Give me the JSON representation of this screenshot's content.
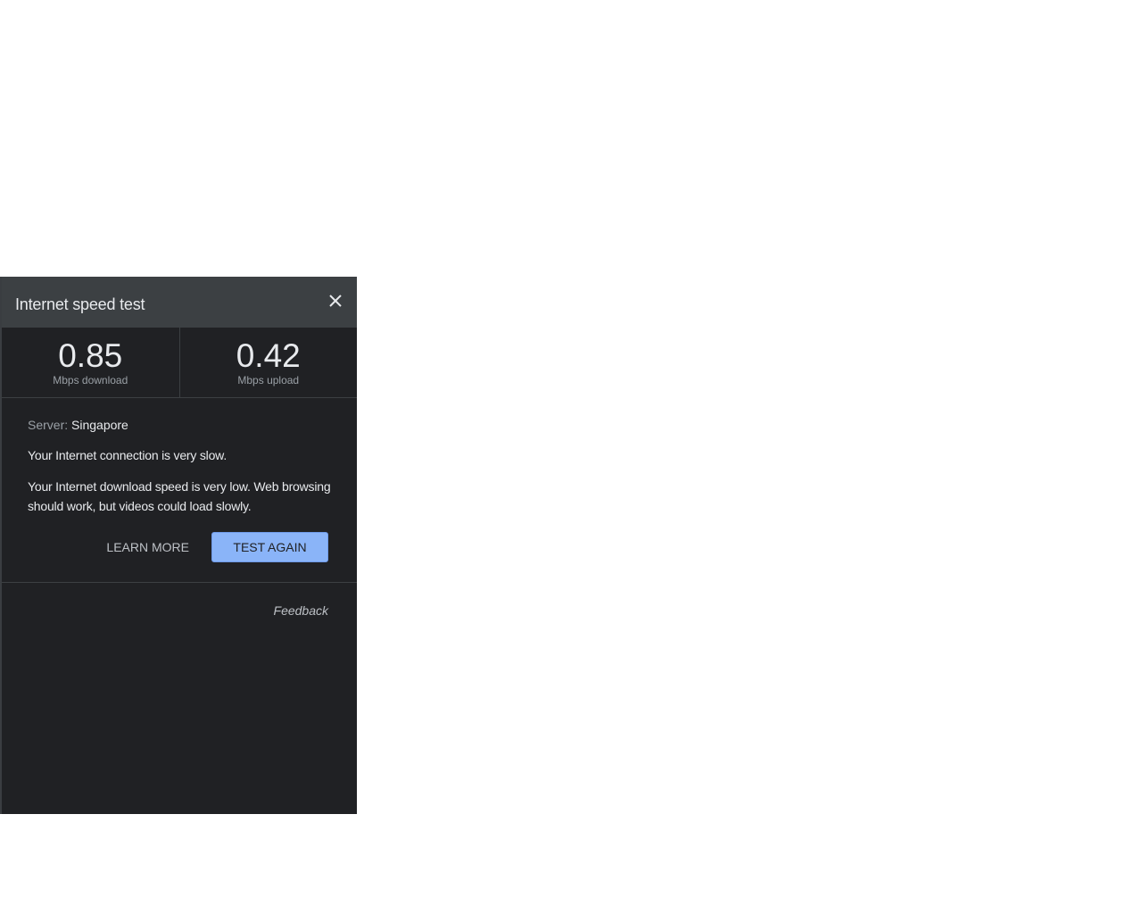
{
  "panel": {
    "title": "Internet speed test",
    "close_icon": "close-icon"
  },
  "stats": {
    "download": {
      "value": "0.85",
      "unit": "Mbps download"
    },
    "upload": {
      "value": "0.42",
      "unit": "Mbps upload"
    }
  },
  "details": {
    "server_label": "Server:",
    "server_name": "Singapore",
    "message": "Your Internet connection is very slow.",
    "description": "Your Internet download speed is very low. Web browsing should work, but videos could load slowly."
  },
  "actions": {
    "learn_more": "LEARN MORE",
    "test_again": "TEST AGAIN"
  },
  "footer": {
    "feedback": "Feedback"
  },
  "colors": {
    "panel_bg": "#202124",
    "header_bg": "#3c4043",
    "accent": "#8ab4f8"
  }
}
